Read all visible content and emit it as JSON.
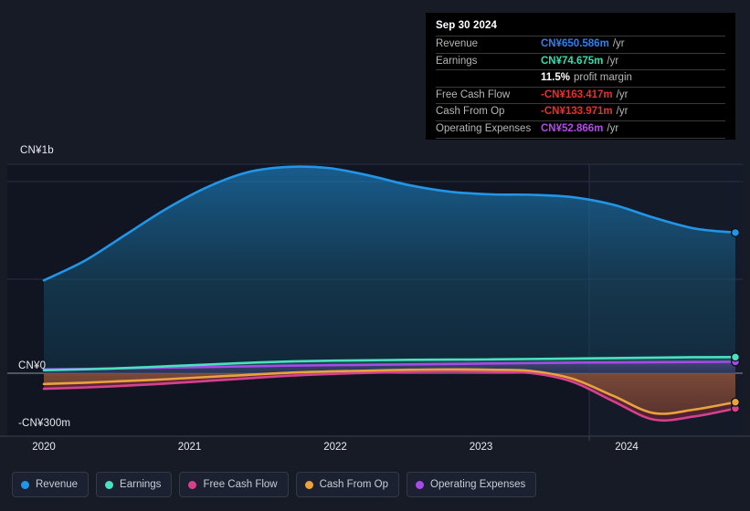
{
  "chart_data": {
    "type": "area",
    "title": "",
    "xlabel": "",
    "ylabel": "",
    "currency": "CN¥",
    "x_ticks": [
      "2020",
      "2021",
      "2022",
      "2023",
      "2024"
    ],
    "y_ticks": [
      "CN¥1b",
      "CN¥0",
      "-CN¥300m"
    ],
    "ylim": [
      -300,
      1000
    ],
    "grid": true,
    "legend_position": "bottom",
    "forecast_divider_year": "2023.8",
    "series": [
      {
        "name": "Revenue",
        "color": "#2196e8",
        "values": [
          430,
          520,
          640,
          760,
          860,
          930,
          955,
          950,
          915,
          870,
          840,
          828,
          826,
          815,
          780,
          720,
          670,
          651
        ]
      },
      {
        "name": "Earnings",
        "color": "#4ae0c0",
        "values": [
          14,
          18,
          24,
          32,
          40,
          48,
          54,
          58,
          60,
          62,
          63,
          64,
          66,
          68,
          70,
          72,
          74,
          74.675
        ]
      },
      {
        "name": "Free Cash Flow",
        "color": "#d4418e",
        "values": [
          -72,
          -66,
          -58,
          -48,
          -36,
          -24,
          -12,
          -4,
          2,
          6,
          8,
          6,
          0,
          -40,
          -130,
          -215,
          -200,
          -163.417
        ]
      },
      {
        "name": "Cash From Op",
        "color": "#e8a33d",
        "values": [
          -50,
          -44,
          -36,
          -28,
          -18,
          -8,
          2,
          8,
          12,
          16,
          18,
          16,
          10,
          -26,
          -105,
          -185,
          -168,
          -133.971
        ]
      },
      {
        "name": "Operating Expenses",
        "color": "#a64ae8",
        "values": [
          18,
          20,
          23,
          26,
          29,
          32,
          35,
          37,
          39,
          41,
          43,
          45,
          47,
          49,
          50,
          51,
          52,
          52.866
        ]
      }
    ]
  },
  "axis": {
    "y_top_label": "CN¥1b",
    "y_zero_label": "CN¥0",
    "y_bottom_label": "-CN¥300m",
    "x_labels": [
      "2020",
      "2021",
      "2022",
      "2023",
      "2024"
    ]
  },
  "tooltip": {
    "date": "Sep 30 2024",
    "rows": [
      {
        "key": "Revenue",
        "value": "CN¥650.586m",
        "unit": "/yr",
        "color": "#2f7ff0"
      },
      {
        "key": "Earnings",
        "value": "CN¥74.675m",
        "unit": "/yr",
        "color": "#2ee0b0"
      },
      {
        "key": "",
        "value": "11.5%",
        "unit": "profit margin",
        "color": "#ffffff"
      },
      {
        "key": "Free Cash Flow",
        "value": "-CN¥163.417m",
        "unit": "/yr",
        "color": "#e8302e"
      },
      {
        "key": "Cash From Op",
        "value": "-CN¥133.971m",
        "unit": "/yr",
        "color": "#e8302e"
      },
      {
        "key": "Operating Expenses",
        "value": "CN¥52.866m",
        "unit": "/yr",
        "color": "#b44ae8"
      }
    ]
  },
  "legend": {
    "items": [
      {
        "label": "Revenue",
        "color": "#2196e8"
      },
      {
        "label": "Earnings",
        "color": "#4ae0c0"
      },
      {
        "label": "Free Cash Flow",
        "color": "#d4418e"
      },
      {
        "label": "Cash From Op",
        "color": "#e8a33d"
      },
      {
        "label": "Operating Expenses",
        "color": "#a64ae8"
      }
    ]
  }
}
